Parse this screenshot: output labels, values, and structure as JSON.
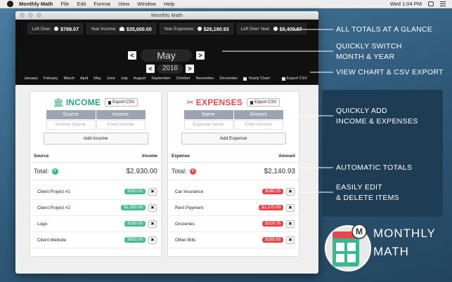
{
  "menubar": {
    "app": "Monthly Math",
    "items": [
      "File",
      "Edit",
      "Format",
      "View",
      "Window",
      "Help"
    ],
    "clock": "Wed 1:04 PM"
  },
  "window": {
    "title": "Monthly Math"
  },
  "stats": [
    {
      "label": "Left Over:",
      "value": "$789.07",
      "icon": "coin-icon"
    },
    {
      "label": "Year Income:",
      "value": "$35,600.00",
      "icon": "bank-icon"
    },
    {
      "label": "Year Expenses:",
      "value": "$26,190.93",
      "icon": "coin-icon"
    },
    {
      "label": "Left Over Year:",
      "value": "$9,409.07",
      "icon": "coin-icon"
    }
  ],
  "period": {
    "month": "May",
    "year": "2016",
    "prev": "<",
    "next": ">"
  },
  "months": [
    "January",
    "Febuary",
    "March",
    "April",
    "May",
    "June",
    "July",
    "August",
    "September",
    "October",
    "November",
    "December"
  ],
  "actions": {
    "yearly_chart": "Yearly Chart",
    "export_csv": "Export CSV"
  },
  "income": {
    "title": "INCOME",
    "export": "Export CSV",
    "col_source": "Source",
    "col_income": "Income",
    "ph_source": "Income Source",
    "ph_income": "Enter Income",
    "add": "Add Income",
    "list_source": "Source",
    "list_income": "Income",
    "total_label": "Total:",
    "count": "4",
    "total": "$2,930.00",
    "items": [
      {
        "name": "Client Project #1",
        "value": "$250.00"
      },
      {
        "name": "Client Project #2",
        "value": "$1,550.00"
      },
      {
        "name": "Logo",
        "value": "$180.00"
      },
      {
        "name": "Client Website",
        "value": "$950.00"
      }
    ]
  },
  "expenses": {
    "title": "EXPENSES",
    "export": "Export CSV",
    "col_name": "Name",
    "col_amount": "Amount",
    "ph_name": "Expense Name",
    "ph_amount": "Enter Amount",
    "add": "Add Expense",
    "list_expense": "Expense",
    "list_amount": "Amount",
    "total_label": "Total:",
    "count": "4",
    "total": "$2,140.93",
    "items": [
      {
        "name": "Car Insurance",
        "value": "$180.25"
      },
      {
        "name": "Rent Payment",
        "value": "$1,575.00"
      },
      {
        "name": "Groceries",
        "value": "$219.75"
      },
      {
        "name": "Other Bills",
        "value": "$165.93"
      }
    ]
  },
  "delete_glyph": "✖",
  "annotations": {
    "totals": "ALL TOTALS AT A GLANCE",
    "switch_1": "QUICKLY SWITCH",
    "switch_2": "MONTH & YEAR",
    "chart": "VIEW CHART & CSV EXPORT",
    "add_1": "QUICKLY ADD",
    "add_2": "INCOME & EXPENSES",
    "auto": "AUTOMATIC TOTALS",
    "edit_1": "EASILY EDIT",
    "edit_2": "& DELETE ITEMS"
  },
  "brand": {
    "line1": "MONTHLY",
    "line2": "MATH",
    "badge": "M"
  },
  "colors": {
    "income": "#2ba37e",
    "expense": "#e54a4f",
    "header": "#101010",
    "accent_bg": "#1e3d55"
  }
}
